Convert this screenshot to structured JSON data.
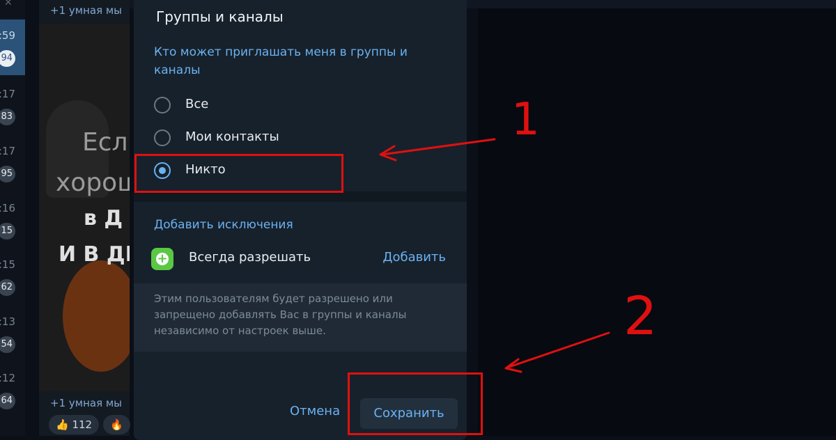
{
  "background": {
    "chat_list": {
      "items": [
        {
          "time": ":59",
          "badge": "94",
          "active": true
        },
        {
          "time": ":17",
          "badge": "83"
        },
        {
          "time": ":17",
          "badge": "95"
        },
        {
          "time": ":16",
          "badge": "15"
        },
        {
          "time": ":15",
          "badge": "62"
        },
        {
          "time": ":13",
          "badge": "54"
        },
        {
          "time": ":12",
          "badge": "64"
        }
      ]
    },
    "feed": {
      "top_caption": "+1 умная мы",
      "bottom_caption": "+1 умная мы",
      "image_text": [
        "Есл",
        "хорош",
        "в Д",
        "И В ДЕ"
      ],
      "reactions": [
        {
          "emoji": "👍",
          "count": "112"
        },
        {
          "emoji": "🔥",
          "count": ""
        }
      ]
    }
  },
  "modal": {
    "title": "Группы и каналы",
    "question": "Кто может приглашать меня в группы и каналы",
    "options": [
      {
        "label": "Все",
        "selected": false
      },
      {
        "label": "Мои контакты",
        "selected": false
      },
      {
        "label": "Никто",
        "selected": true
      }
    ],
    "exceptions": {
      "title": "Добавить исключения",
      "always_allow_label": "Всегда разрешать",
      "add_label": "Добавить",
      "note": "Этим пользователям будет разрешено или запрещено добавлять Вас в группы и каналы независимо от настроек выше."
    },
    "buttons": {
      "cancel": "Отмена",
      "save": "Сохранить"
    }
  },
  "annotations": {
    "marker_1": "1",
    "marker_2": "2",
    "color": "#e01010"
  }
}
